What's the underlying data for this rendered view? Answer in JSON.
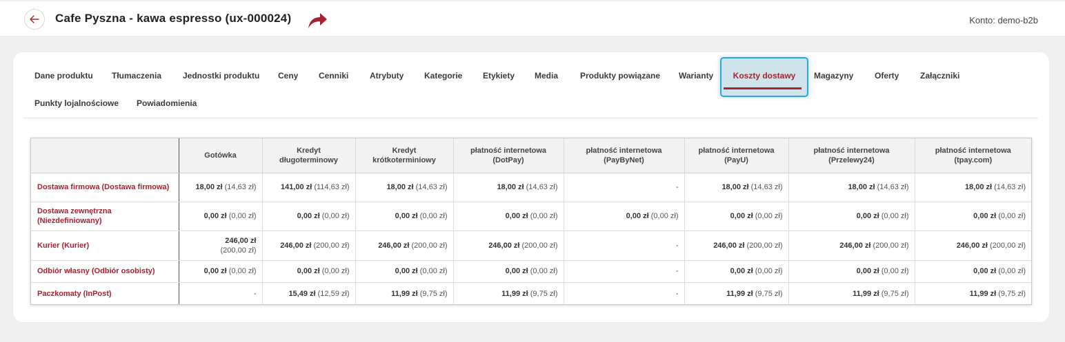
{
  "header": {
    "title": "Cafe Pyszna - kawa espresso (ux-000024)",
    "account": "Konto: demo-b2b"
  },
  "colors": {
    "accent": "#a72230",
    "active_tab_bg": "#cfe3eb",
    "active_tab_border": "#2ea7d6"
  },
  "icons": {
    "back": "arrow-left-icon",
    "share": "share-arrow-icon"
  },
  "tabs": [
    {
      "label": "Dane produktu"
    },
    {
      "label": "Tłumaczenia"
    },
    {
      "label": "Jednostki produktu"
    },
    {
      "label": "Ceny"
    },
    {
      "label": "Cenniki"
    },
    {
      "label": "Atrybuty"
    },
    {
      "label": "Kategorie"
    },
    {
      "label": "Etykiety"
    },
    {
      "label": "Media"
    },
    {
      "label": "Produkty powiązane"
    },
    {
      "label": "Warianty"
    },
    {
      "label": "Koszty dostawy",
      "active": true
    },
    {
      "label": "Magazyny"
    },
    {
      "label": "Oferty"
    },
    {
      "label": "Załączniki"
    },
    {
      "label": "Punkty lojalnościowe"
    },
    {
      "label": "Powiadomienia"
    }
  ],
  "table": {
    "columns": [
      "",
      "Gotówka",
      "Kredyt długoterminowy",
      "Kredyt krótkoterminiowy",
      "płatność internetowa (DotPay)",
      "płatność internetowa (PayByNet)",
      "płatność internetowa (PayU)",
      "płatność internetowa (Przelewy24)",
      "płatność internetowa (tpay.com)"
    ],
    "rows": [
      {
        "method": "Dostawa firmowa (Dostawa firmowa)",
        "cells": [
          {
            "price": "18,00 zł",
            "net": "(14,63 zł)"
          },
          {
            "price": "141,00 zł",
            "net": "(114,63 zł)"
          },
          {
            "price": "18,00 zł",
            "net": "(14,63 zł)"
          },
          {
            "price": "18,00 zł",
            "net": "(14,63 zł)"
          },
          {
            "empty": "-"
          },
          {
            "price": "18,00 zł",
            "net": "(14,63 zł)"
          },
          {
            "price": "18,00 zł",
            "net": "(14,63 zł)"
          },
          {
            "price": "18,00 zł",
            "net": "(14,63 zł)"
          }
        ]
      },
      {
        "method": "Dostawa zewnętrzna (Niezdefiniowany)",
        "cells": [
          {
            "price": "0,00 zł",
            "net": "(0,00 zł)"
          },
          {
            "price": "0,00 zł",
            "net": "(0,00 zł)"
          },
          {
            "price": "0,00 zł",
            "net": "(0,00 zł)"
          },
          {
            "price": "0,00 zł",
            "net": "(0,00 zł)"
          },
          {
            "price": "0,00 zł",
            "net": "(0,00 zł)"
          },
          {
            "price": "0,00 zł",
            "net": "(0,00 zł)"
          },
          {
            "price": "0,00 zł",
            "net": "(0,00 zł)"
          },
          {
            "price": "0,00 zł",
            "net": "(0,00 zł)"
          }
        ]
      },
      {
        "method": "Kurier (Kurier)",
        "cells": [
          {
            "price": "246,00 zł",
            "net": "(200,00 zł)",
            "wrap": true
          },
          {
            "price": "246,00 zł",
            "net": "(200,00 zł)"
          },
          {
            "price": "246,00 zł",
            "net": "(200,00 zł)"
          },
          {
            "price": "246,00 zł",
            "net": "(200,00 zł)"
          },
          {
            "empty": "-"
          },
          {
            "price": "246,00 zł",
            "net": "(200,00 zł)"
          },
          {
            "price": "246,00 zł",
            "net": "(200,00 zł)"
          },
          {
            "price": "246,00 zł",
            "net": "(200,00 zł)"
          }
        ]
      },
      {
        "method": "Odbiór własny (Odbiór osobisty)",
        "cells": [
          {
            "price": "0,00 zł",
            "net": "(0,00 zł)"
          },
          {
            "price": "0,00 zł",
            "net": "(0,00 zł)"
          },
          {
            "price": "0,00 zł",
            "net": "(0,00 zł)"
          },
          {
            "price": "0,00 zł",
            "net": "(0,00 zł)"
          },
          {
            "empty": "-"
          },
          {
            "price": "0,00 zł",
            "net": "(0,00 zł)"
          },
          {
            "price": "0,00 zł",
            "net": "(0,00 zł)"
          },
          {
            "price": "0,00 zł",
            "net": "(0,00 zł)"
          }
        ]
      },
      {
        "method": "Paczkomaty (InPost)",
        "cells": [
          {
            "empty": "-"
          },
          {
            "price": "15,49 zł",
            "net": "(12,59 zł)"
          },
          {
            "price": "11,99 zł",
            "net": "(9,75 zł)"
          },
          {
            "price": "11,99 zł",
            "net": "(9,75 zł)"
          },
          {
            "empty": "-"
          },
          {
            "price": "11,99 zł",
            "net": "(9,75 zł)"
          },
          {
            "price": "11,99 zł",
            "net": "(9,75 zł)"
          },
          {
            "price": "11,99 zł",
            "net": "(9,75 zł)"
          }
        ]
      }
    ]
  }
}
